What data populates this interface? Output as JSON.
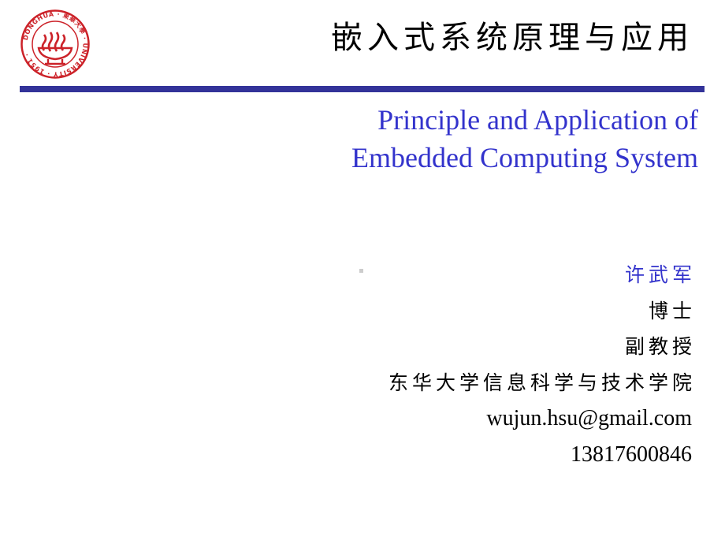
{
  "logo": {
    "icon": "donghua-university-seal",
    "text_top": "東華大學",
    "text_ring": "DONGHUA UNIVERSITY",
    "year": "1951",
    "color": "#cc2229"
  },
  "header": {
    "title_cn": "嵌入式系统原理与应用",
    "rule_color": "#333399"
  },
  "subtitle": {
    "line1": "Principle and Application of",
    "line2": "Embedded Computing System",
    "color": "#3333cc"
  },
  "author": {
    "name": "许武军",
    "degree": "博士",
    "position": "副教授",
    "affiliation": "东华大学信息科学与技术学院",
    "email": "wujun.hsu@gmail.com",
    "phone": "13817600846"
  }
}
